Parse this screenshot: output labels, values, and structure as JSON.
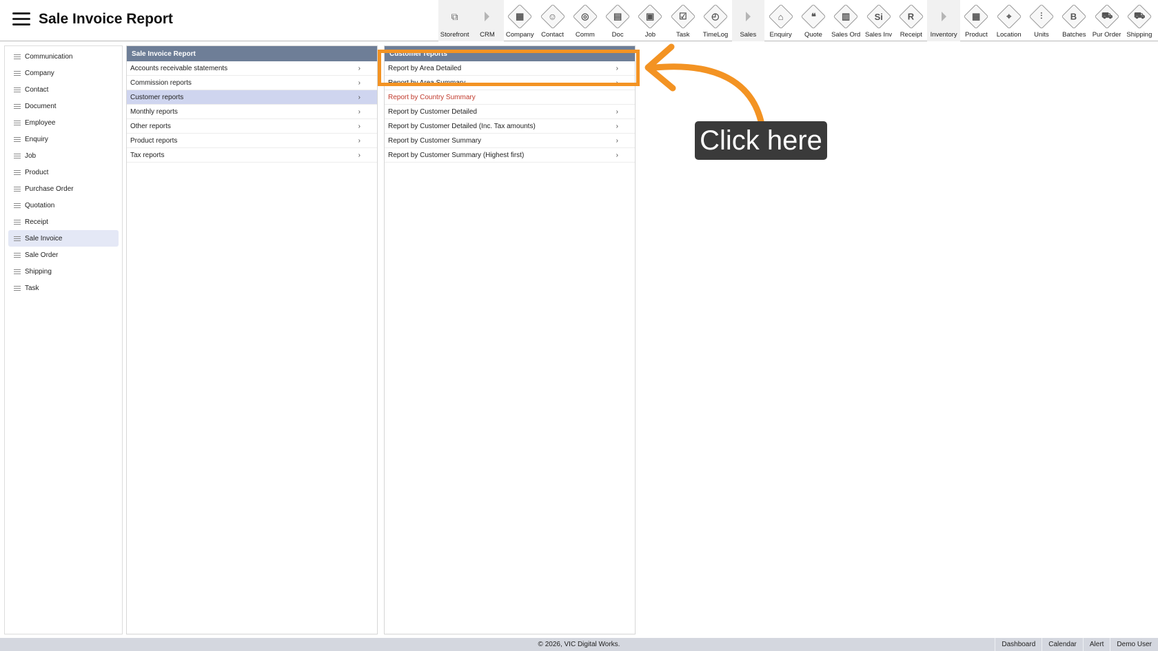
{
  "header": {
    "title": "Sale Invoice Report"
  },
  "toolbar": [
    {
      "label": "Storefront",
      "icon": "external-link-icon",
      "glyph": "⧉"
    },
    {
      "label": "CRM",
      "icon": "caret-right-icon",
      "glyph": ""
    },
    {
      "label": "Company",
      "icon": "company-icon",
      "glyph": "▦"
    },
    {
      "label": "Contact",
      "icon": "contact-icon",
      "glyph": "☺"
    },
    {
      "label": "Comm",
      "icon": "comm-icon",
      "glyph": "◎"
    },
    {
      "label": "Doc",
      "icon": "doc-icon",
      "glyph": "▤"
    },
    {
      "label": "Job",
      "icon": "job-icon",
      "glyph": "▣"
    },
    {
      "label": "Task",
      "icon": "task-icon",
      "glyph": "☑"
    },
    {
      "label": "TimeLog",
      "icon": "timelog-icon",
      "glyph": "◴"
    },
    {
      "label": "Sales",
      "icon": "caret-right-icon",
      "glyph": ""
    },
    {
      "label": "Enquiry",
      "icon": "enquiry-icon",
      "glyph": "⌂"
    },
    {
      "label": "Quote",
      "icon": "quote-icon",
      "glyph": "❝"
    },
    {
      "label": "Sales Ord",
      "icon": "sales-order-icon",
      "glyph": "▥"
    },
    {
      "label": "Sales Inv",
      "icon": "sales-invoice-icon",
      "glyph": "Si"
    },
    {
      "label": "Receipt",
      "icon": "receipt-icon",
      "glyph": "R"
    },
    {
      "label": "Inventory",
      "icon": "caret-right-icon",
      "glyph": ""
    },
    {
      "label": "Product",
      "icon": "product-icon",
      "glyph": "▦"
    },
    {
      "label": "Location",
      "icon": "location-icon",
      "glyph": "⌖"
    },
    {
      "label": "Units",
      "icon": "units-icon",
      "glyph": "⫶"
    },
    {
      "label": "Batches",
      "icon": "batches-icon",
      "glyph": "B"
    },
    {
      "label": "Pur Order",
      "icon": "purchase-order-icon",
      "glyph": "⛟"
    },
    {
      "label": "Shipping",
      "icon": "shipping-icon",
      "glyph": "⛟"
    }
  ],
  "sidebar": {
    "items": [
      {
        "label": "Communication"
      },
      {
        "label": "Company"
      },
      {
        "label": "Contact"
      },
      {
        "label": "Document"
      },
      {
        "label": "Employee"
      },
      {
        "label": "Enquiry"
      },
      {
        "label": "Job"
      },
      {
        "label": "Product"
      },
      {
        "label": "Purchase Order"
      },
      {
        "label": "Quotation"
      },
      {
        "label": "Receipt"
      },
      {
        "label": "Sale Invoice",
        "active": true
      },
      {
        "label": "Sale Order"
      },
      {
        "label": "Shipping"
      },
      {
        "label": "Task"
      }
    ]
  },
  "report_panel": {
    "header": "Sale Invoice Report",
    "items": [
      {
        "label": "Accounts receivable statements"
      },
      {
        "label": "Commission reports"
      },
      {
        "label": "Customer reports",
        "active": true
      },
      {
        "label": "Monthly reports"
      },
      {
        "label": "Other reports"
      },
      {
        "label": "Product reports"
      },
      {
        "label": "Tax reports"
      }
    ]
  },
  "customer_panel": {
    "header": "Customer reports",
    "items": [
      {
        "label": "Report by Area Detailed",
        "chevron": true
      },
      {
        "label": "Report by Area Summary",
        "chevron": true
      },
      {
        "label": "Report by Country Summary",
        "chevron": false,
        "red": true
      },
      {
        "label": "Report by Customer Detailed",
        "chevron": true
      },
      {
        "label": "Report by Customer Detailed (Inc. Tax amounts)",
        "chevron": true
      },
      {
        "label": "Report by Customer Summary",
        "chevron": true
      },
      {
        "label": "Report by Customer Summary (Highest first)",
        "chevron": true
      }
    ]
  },
  "annotation": {
    "callout": "Click here",
    "color": "#f39323"
  },
  "footer": {
    "copyright": "© 2026, VIC Digital Works.",
    "links": [
      "Dashboard",
      "Calendar",
      "Alert",
      "Demo User"
    ]
  }
}
